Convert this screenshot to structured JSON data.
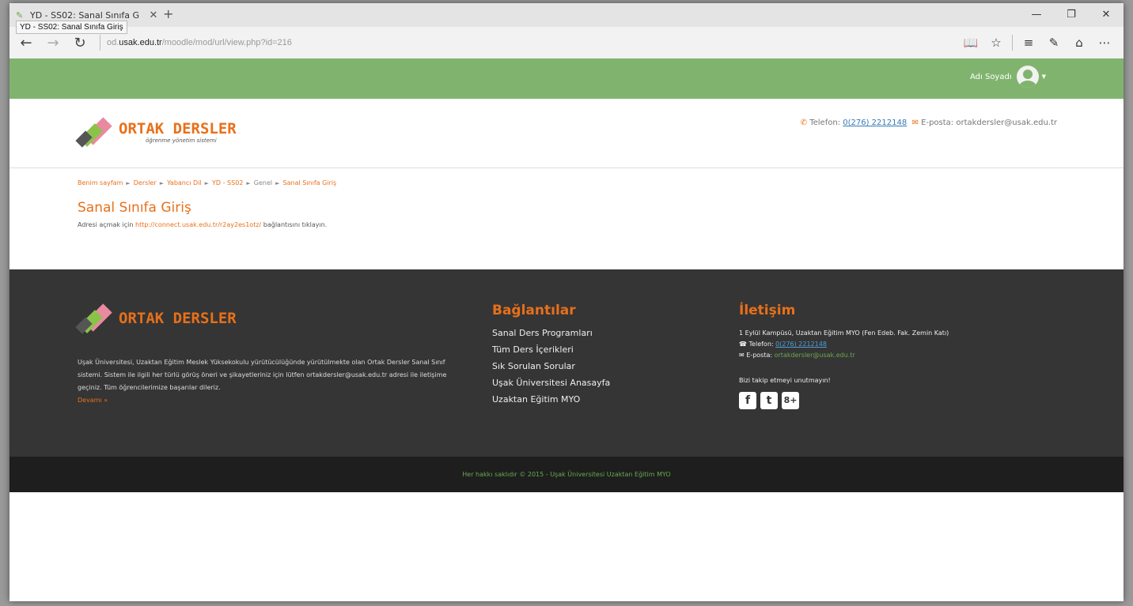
{
  "browser": {
    "tab_title": "YD - SS02: Sanal Sınıfa G",
    "tab_tooltip": "YD - SS02: Sanal Sınıfa Giriş",
    "new_tab_glyph": "+",
    "address_prefix": "od.",
    "address_host": "usak.edu.tr",
    "address_path": "/moodle/mod/url/view.php?id=216"
  },
  "site": {
    "user_name": "Adı Soyadı",
    "logo_title": "ORTAK DERSLER",
    "logo_subtitle": "öğrenme yönetim sistemi",
    "phone_label": "Telefon:",
    "phone": "0(276) 2212148",
    "email_label": "E-posta:",
    "email": "ortakdersler@usak.edu.tr"
  },
  "breadcrumb": {
    "items": [
      "Benim sayfam",
      "Dersler",
      "Yabancı Dil",
      "YD - SS02",
      "Genel",
      "Sanal Sınıfa Giriş"
    ]
  },
  "main": {
    "title": "Sanal Sınıfa Giriş",
    "desc_prefix": "Adresi açmak için",
    "link": "http://connect.usak.edu.tr/r2ay2es1otz/",
    "desc_suffix": "bağlantısını tıklayın."
  },
  "footer": {
    "about": "Uşak Üniversitesi, Uzaktan Eğitim Meslek Yüksekokulu yürütücülüğünde yürütülmekte olan Ortak Dersler Sanal Sınıf sistemi. Sistem ile ilgili her türlü görüş öneri ve şikayetleriniz için lütfen ortakdersler@usak.edu.tr adresi ile iletişime geçiniz. Tüm öğrencilerimize başarılar dileriz.",
    "more": "Devamı »",
    "links_heading": "Bağlantılar",
    "links": [
      "Sanal Ders Programları",
      "Tüm Ders İçerikleri",
      "Sık Sorulan Sorular",
      "Uşak Üniversitesi Anasayfa",
      "Uzaktan Eğitim MYO"
    ],
    "contact_heading": "İletişim",
    "address": "1 Eylül Kampüsü, Uzaktan Eğitim MYO (Fen Edeb. Fak. Zemin Katı)",
    "phone_label": "Telefon:",
    "phone": "0(276) 2212148",
    "email_label": "E-posta:",
    "email": "ortakdersler@usak.edu.tr",
    "follow": "Bizi takip etmeyi unutmayın!",
    "copyright": "Her hakkı saklıdır © 2015 - Uşak Üniversitesi Uzaktan Eğitim MYO"
  },
  "icons": {
    "facebook": "f",
    "twitter": "t",
    "google_plus": "8+"
  }
}
